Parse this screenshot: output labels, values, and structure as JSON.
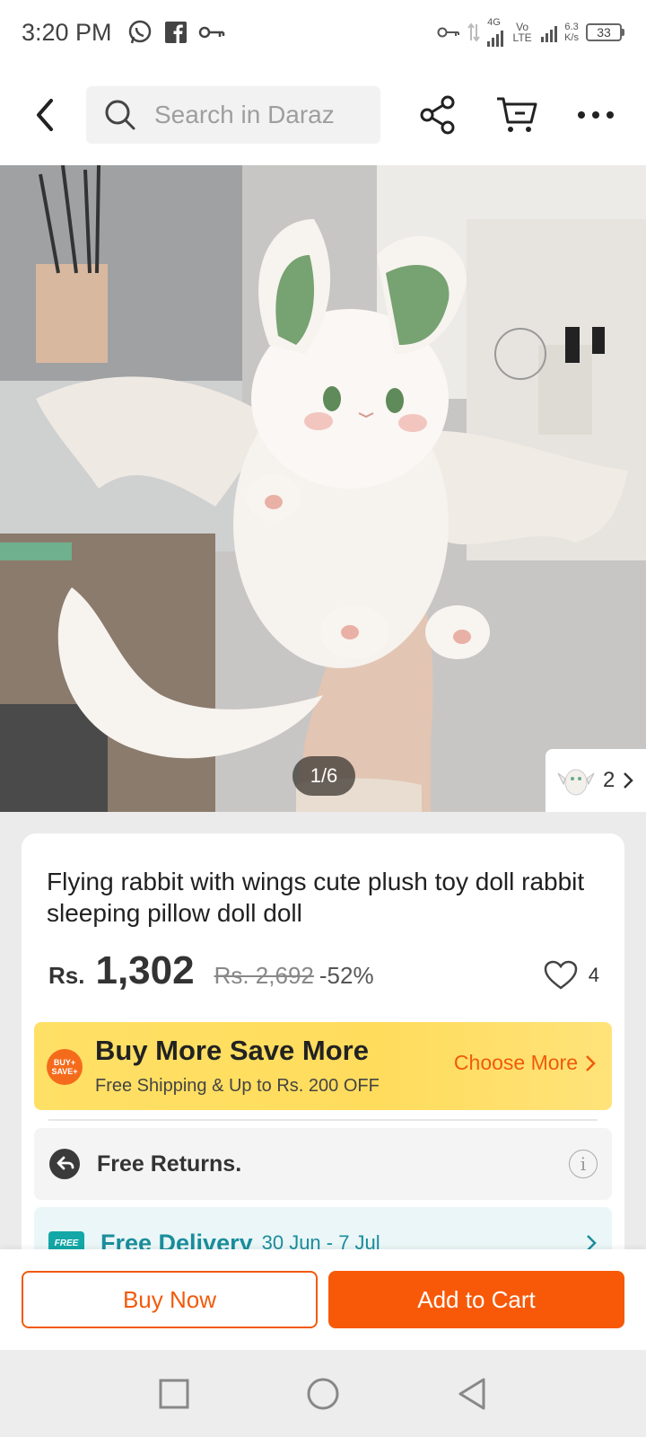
{
  "status_bar": {
    "time": "3:20 PM",
    "net_4g": "4G",
    "volte": "Vo LTE",
    "speed_value": "6.3",
    "speed_unit": "K/s",
    "battery": "33"
  },
  "nav": {
    "search_placeholder": "Search in Daraz"
  },
  "gallery": {
    "counter": "1/6",
    "variant_count": "2"
  },
  "product": {
    "title": "Flying rabbit with wings cute plush toy doll rabbit sleeping pillow doll doll",
    "currency": "Rs.",
    "price": "1,302",
    "original_price": "Rs. 2,692",
    "discount": "-52%",
    "wishlist_count": "4"
  },
  "promo": {
    "badge_line1": "BUY+",
    "badge_line2": "SAVE+",
    "title": "Buy More Save More",
    "subtitle": "Free Shipping & Up to Rs. 200 OFF",
    "cta": "Choose More"
  },
  "returns": {
    "label": "Free Returns."
  },
  "delivery": {
    "tag": "FREE",
    "label": "Free Delivery",
    "date": "30 Jun - 7 Jul"
  },
  "actions": {
    "buy_now": "Buy Now",
    "add_to_cart": "Add to Cart"
  },
  "colors": {
    "brand_orange": "#f75908",
    "promo_yellow": "#ffe066",
    "delivery_teal": "#1a8d9c"
  }
}
